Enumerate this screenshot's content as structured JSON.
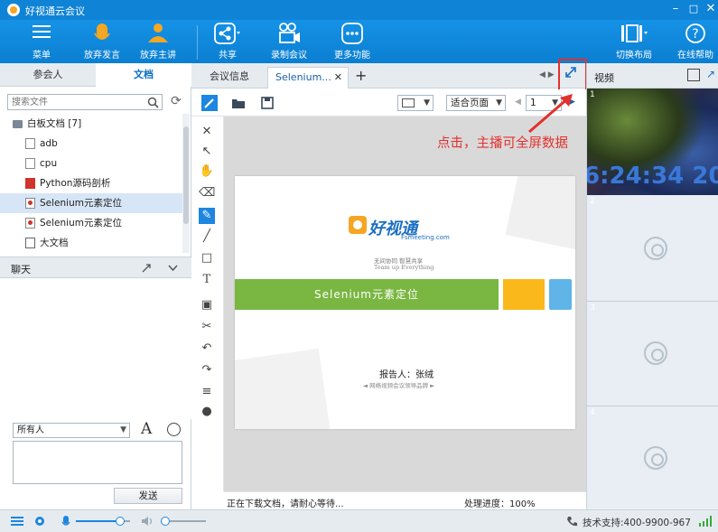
{
  "window": {
    "title": "好视通云会议"
  },
  "toolbar": {
    "menu": "菜单",
    "give_up_speaking": "放弃发言",
    "give_up_host": "放弃主讲",
    "share": "共享",
    "record": "录制会议",
    "more": "更多功能",
    "switch_layout": "切换布局",
    "online_help": "在线帮助"
  },
  "left": {
    "tabs": [
      "参会人",
      "文档"
    ],
    "search_placeholder": "搜索文件",
    "folder": "白板文档 [7]",
    "files": [
      "adb",
      "cpu",
      "Python源码剖析",
      "Selenium元素定位",
      "Selenium元素定位",
      "大文档"
    ],
    "chat_title": "聊天",
    "recipient": "所有人",
    "send": "发送"
  },
  "center": {
    "tabs": [
      "会议信息",
      "Selenium..."
    ],
    "fit_page": "适合页面",
    "page_num": "1",
    "slide": {
      "brand": "好视通",
      "brand_sub": "Fsmeeting.com",
      "tagline_cn": "无间协同 智慧共享",
      "tagline_en": "Team up Everything",
      "title": "Selenium元素定位",
      "reporter": "报告人：张绒",
      "footer": "◄  网络视频会议领导品牌  ►"
    },
    "status_left": "正在下载文档，请耐心等待...",
    "status_right": "处理进度：100%",
    "annotation": "点击，主播可全屏数据"
  },
  "right": {
    "title": "视频",
    "clock": "6:24:34 20",
    "cells": [
      "1",
      "2",
      "3",
      "4"
    ]
  },
  "statusbar": {
    "support": "技术支持:400-9900-967"
  },
  "colors": {
    "brand_blue": "#0f83d6",
    "accent_red": "#e3312d",
    "green": "#7ab642"
  }
}
